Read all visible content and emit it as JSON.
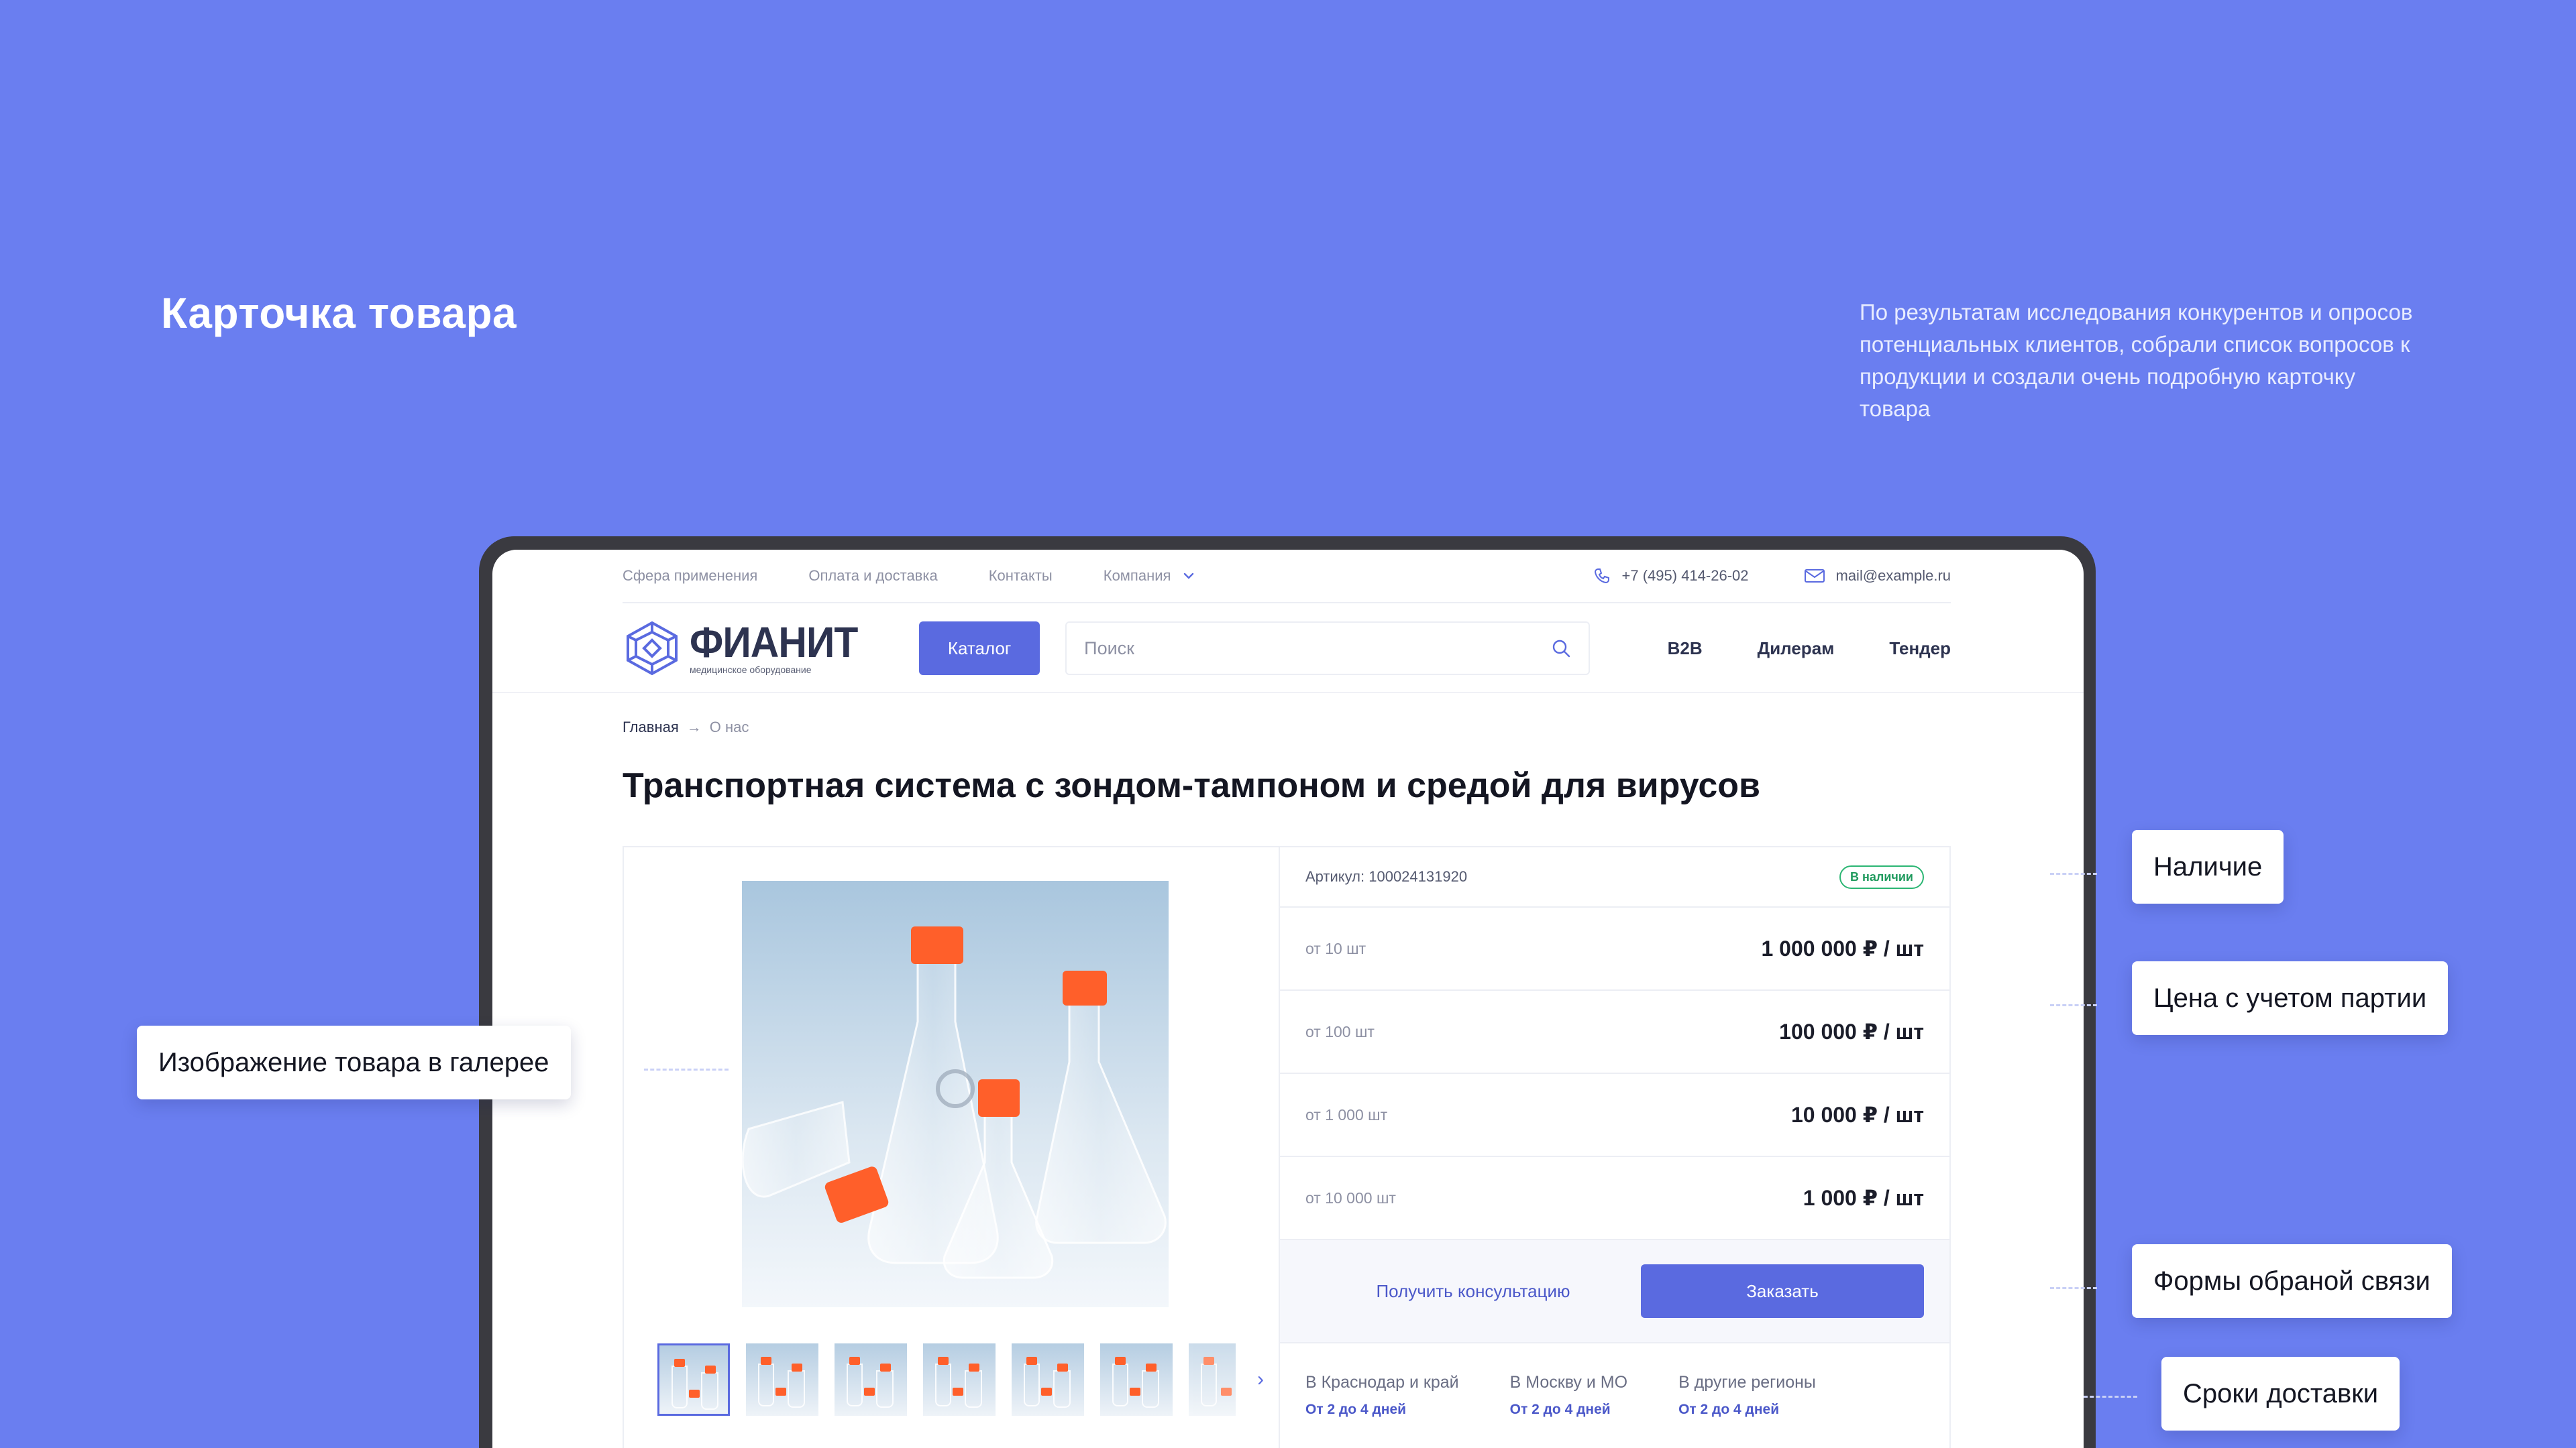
{
  "slide": {
    "title": "Карточка товара",
    "description": "По результатам исследования конкурентов и опросов потенциальных клиентов, собрали список вопросов к продукции и создали очень подробную карточку товара"
  },
  "topnav": {
    "links": [
      "Сфера применения",
      "Оплата и доставка",
      "Контакты",
      "Компания"
    ],
    "phone": "+7 (495) 414-26-02",
    "email": "mail@example.ru"
  },
  "header": {
    "logo_name": "ФИАНИТ",
    "logo_sub": "медицинское оборудование",
    "catalog_label": "Каталог",
    "search_placeholder": "Поиск",
    "links": [
      "B2B",
      "Дилерам",
      "Тендер"
    ]
  },
  "breadcrumb": {
    "home": "Главная",
    "arrow": "→",
    "current": "О нас"
  },
  "product": {
    "title": "Транспортная система с зондом-тампоном и средой для вирусов",
    "article": "Артикул: 100024131920",
    "availability": "В наличии",
    "prices": [
      {
        "qty": "от 10 шт",
        "price": "1 000 000 ₽ / шт"
      },
      {
        "qty": "от 100 шт",
        "price": "100 000 ₽ / шт"
      },
      {
        "qty": "от 1 000 шт",
        "price": "10 000 ₽ / шт"
      },
      {
        "qty": "от 10 000 шт",
        "price": "1 000 ₽ / шт"
      }
    ],
    "consult_label": "Получить консультацию",
    "order_label": "Заказать",
    "delivery": [
      {
        "region": "В Краснодар и край",
        "term": "От 2 до 4 дней"
      },
      {
        "region": "В Москву и МО",
        "term": "От 2 до 4 дней"
      },
      {
        "region": "В другие регионы",
        "term": "От 2 до 4 дней"
      }
    ],
    "thumbs_next": "›"
  },
  "callouts": {
    "gallery": "Изображение товара в галерее",
    "availability": "Наличие",
    "price": "Цена с учетом партии",
    "forms": "Формы обраной связи",
    "delivery": "Сроки доставки"
  },
  "colors": {
    "background": "#6a7ef0",
    "accent": "#5a6ae0",
    "success": "#2bb673",
    "cap_orange": "#ff5f2a"
  }
}
